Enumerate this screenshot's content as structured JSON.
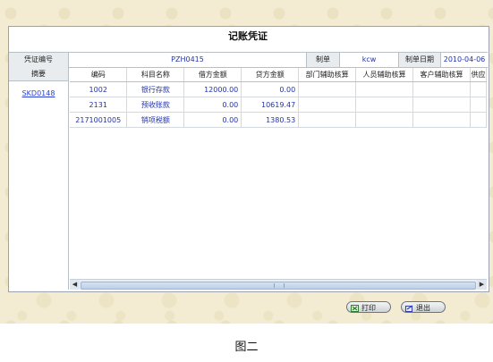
{
  "title": "记账凭证",
  "header": {
    "voucher_no_label": "凭证编号",
    "voucher_no": "PZH0415",
    "maker_label": "制单",
    "maker": "kcw",
    "date_label": "制单日期",
    "date": "2010-04-06"
  },
  "summary": {
    "label": "摘要",
    "link": "SKD0148"
  },
  "grid": {
    "columns": [
      "编码",
      "科目名称",
      "借方金额",
      "贷方金额",
      "部门辅助核算",
      "人员辅助核算",
      "客户辅助核算",
      "供应"
    ],
    "rows": [
      [
        "1002",
        "银行存款",
        "12000.00",
        "0.00",
        "",
        "",
        "",
        ""
      ],
      [
        "2131",
        "预收账款",
        "0.00",
        "10619.47",
        "",
        "",
        "",
        ""
      ],
      [
        "2171001005",
        "销项税额",
        "0.00",
        "1380.53",
        "",
        "",
        "",
        ""
      ]
    ]
  },
  "scroll": {
    "left": "◀",
    "right": "▶"
  },
  "buttons": {
    "print": "打印",
    "exit": "退出"
  },
  "caption": "图二"
}
